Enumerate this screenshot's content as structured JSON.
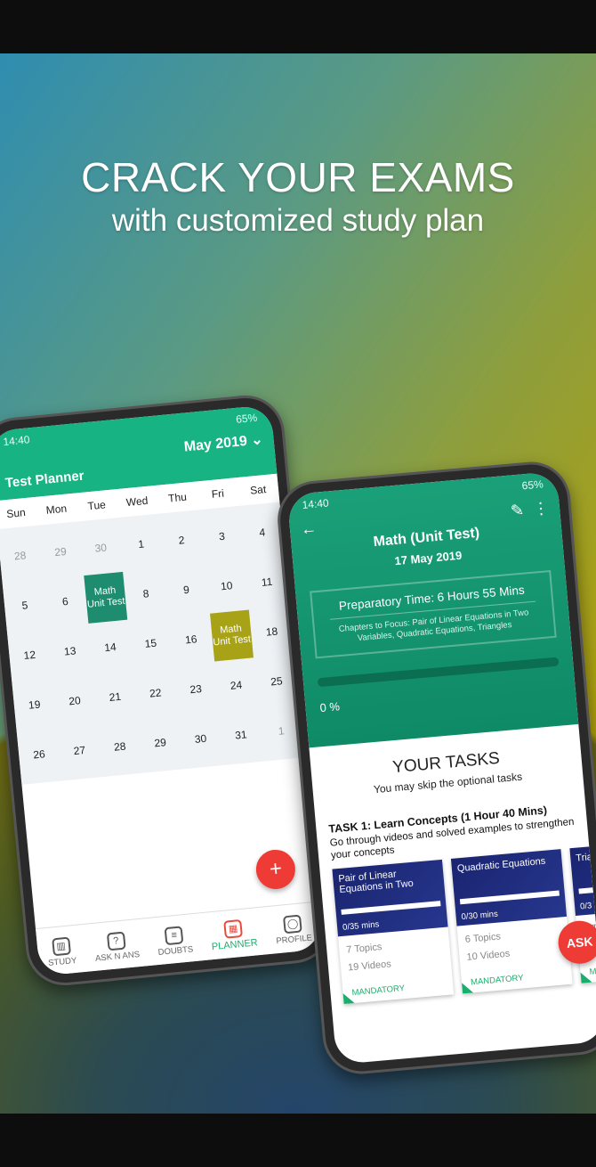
{
  "promo": {
    "headline": "CRACK YOUR EXAMS",
    "subheadline": "with customized study plan"
  },
  "planner": {
    "status": {
      "time": "14:40",
      "battery": "65%"
    },
    "title": "Test Planner",
    "month": "May 2019",
    "month_icon": "chevron-down-icon",
    "weekdays": [
      "Sun",
      "Mon",
      "Tue",
      "Wed",
      "Thu",
      "Fri",
      "Sat"
    ],
    "weeks": [
      [
        {
          "d": "28",
          "muted": true
        },
        {
          "d": "29",
          "muted": true
        },
        {
          "d": "30",
          "muted": true
        },
        {
          "d": "1"
        },
        {
          "d": "2"
        },
        {
          "d": "3"
        },
        {
          "d": "4"
        }
      ],
      [
        {
          "d": "5"
        },
        {
          "d": "6"
        },
        {
          "d": "7",
          "event": "Math Unit Test",
          "color": "#1e8c6e"
        },
        {
          "d": "8"
        },
        {
          "d": "9"
        },
        {
          "d": "10"
        },
        {
          "d": "11"
        }
      ],
      [
        {
          "d": "12"
        },
        {
          "d": "13"
        },
        {
          "d": "14"
        },
        {
          "d": "15"
        },
        {
          "d": "16"
        },
        {
          "d": "17",
          "event": "Math Unit Test",
          "color": "#a8a316"
        },
        {
          "d": "18"
        }
      ],
      [
        {
          "d": "19"
        },
        {
          "d": "20"
        },
        {
          "d": "21"
        },
        {
          "d": "22"
        },
        {
          "d": "23"
        },
        {
          "d": "24"
        },
        {
          "d": "25"
        }
      ],
      [
        {
          "d": "26"
        },
        {
          "d": "27"
        },
        {
          "d": "28"
        },
        {
          "d": "29"
        },
        {
          "d": "30"
        },
        {
          "d": "31"
        },
        {
          "d": "1",
          "muted": true
        }
      ]
    ],
    "fab": "+",
    "nav": [
      {
        "label": "STUDY",
        "icon": "book-icon"
      },
      {
        "label": "ASK N ANS",
        "icon": "question-icon"
      },
      {
        "label": "DOUBTS",
        "icon": "chat-icon"
      },
      {
        "label": "PLANNER",
        "icon": "calendar-icon",
        "active": true
      },
      {
        "label": "PROFILE",
        "icon": "person-icon"
      }
    ],
    "accent": "#17b382"
  },
  "detail": {
    "status": {
      "time": "14:40",
      "battery": "65%"
    },
    "title": "Math  (Unit Test)",
    "date": "17 May 2019",
    "prep_time": "Preparatory Time:  6 Hours 55 Mins",
    "chapters": "Chapters to Focus: Pair of Linear Equations in Two Variables, Quadratic Equations, Triangles",
    "progress_percent": 0,
    "progress_label": "0 %",
    "tasks_heading": "YOUR TASKS",
    "tasks_sub": "You may skip the optional tasks",
    "task1": {
      "title": "TASK 1: Learn Concepts (1 Hour 40 Mins)",
      "desc": "Go through videos and solved examples to strengthen your concepts"
    },
    "cards": [
      {
        "title": "Pair of Linear Equations in Two",
        "mins": "0/35 mins",
        "topics": "7 Topics",
        "videos": "19 Videos",
        "tag": "MANDATORY"
      },
      {
        "title": "Quadratic Equations",
        "mins": "0/30 mins",
        "topics": "6 Topics",
        "videos": "10 Videos",
        "tag": "MANDATORY"
      },
      {
        "title": "Tria",
        "mins": "0/3",
        "topics": "7 T",
        "videos": "18",
        "tag": "MA"
      }
    ],
    "ask": "ASK"
  }
}
